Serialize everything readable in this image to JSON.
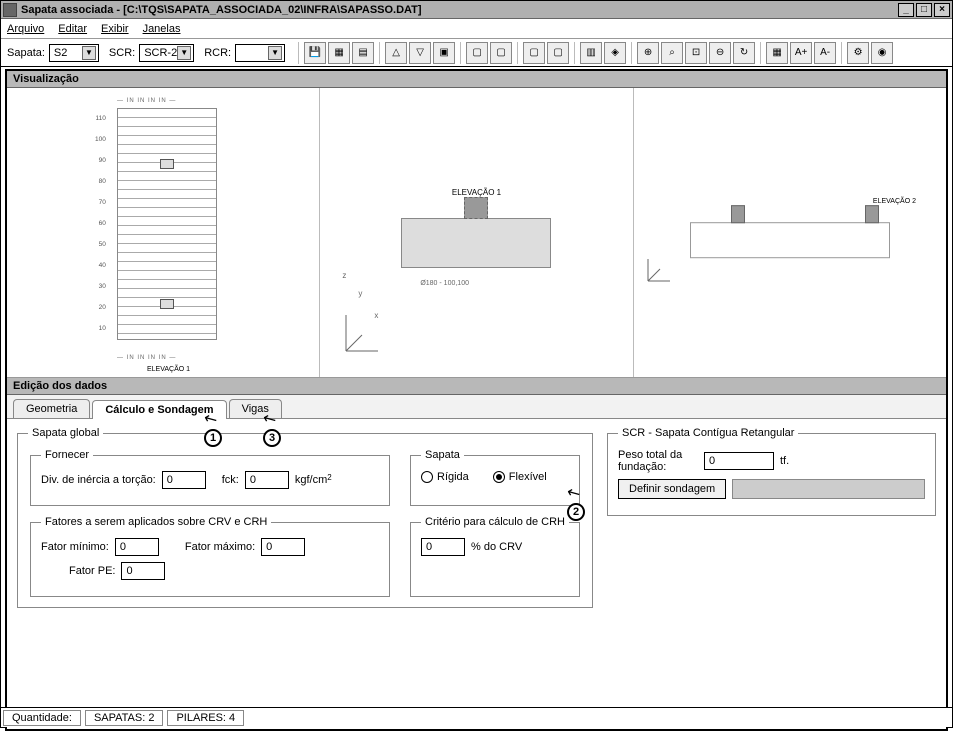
{
  "title": "Sapata associada -  [C:\\TQS\\SAPATA_ASSOCIADA_02\\INFRA\\SAPASSO.DAT]",
  "menu": {
    "arquivo": "Arquivo",
    "editar": "Editar",
    "exibir": "Exibir",
    "janelas": "Janelas"
  },
  "toolbar": {
    "sapata_label": "Sapata:",
    "sapata_value": "S2",
    "scr_label": "SCR:",
    "scr_value": "SCR-2",
    "rcr_label": "RCR:",
    "rcr_value": ""
  },
  "section_viz": "Visualização",
  "section_edit": "Edição dos dados",
  "viz": {
    "plan_label": "ELEVAÇÃO 1",
    "plan_footer": "ELEVAÇÃO 1",
    "axis_x": "x",
    "axis_y": "y",
    "axis_z": "z",
    "elev2_label": "ELEVAÇÃO 2"
  },
  "tabs": {
    "geometria": "Geometria",
    "calculo": "Cálculo e Sondagem",
    "vigas": "Vigas"
  },
  "callouts": {
    "one": "1",
    "two": "2",
    "three": "3"
  },
  "sapata_global": {
    "legend": "Sapata global",
    "fornecer": "Fornecer",
    "div_inercia": "Div. de inércia a torção:",
    "div_val": "0",
    "fck": "fck:",
    "fck_val": "0",
    "fck_unit": "kgf/cm",
    "fck_unit_sup": "2",
    "fatores_legend": "Fatores a serem aplicados sobre CRV e CRH",
    "fator_min": "Fator mínimo:",
    "fator_min_val": "0",
    "fator_max": "Fator máximo:",
    "fator_max_val": "0",
    "fator_pe": "Fator PE:",
    "fator_pe_val": "0",
    "sapata_legend": "Sapata",
    "rigida": "Rígida",
    "flexivel": "Flexível",
    "criterio_legend": "Critério para cálculo de CRH",
    "criterio_val": "0",
    "criterio_unit": "% do CRV"
  },
  "scr": {
    "legend": "SCR - Sapata Contígua Retangular",
    "peso_label": "Peso total da fundação:",
    "peso_val": "0",
    "peso_unit": "tf.",
    "definir": "Definir sondagem"
  },
  "status": {
    "quantidade": "Quantidade:",
    "sapatas": "SAPATAS: 2",
    "pilares": "PILARES: 4"
  }
}
